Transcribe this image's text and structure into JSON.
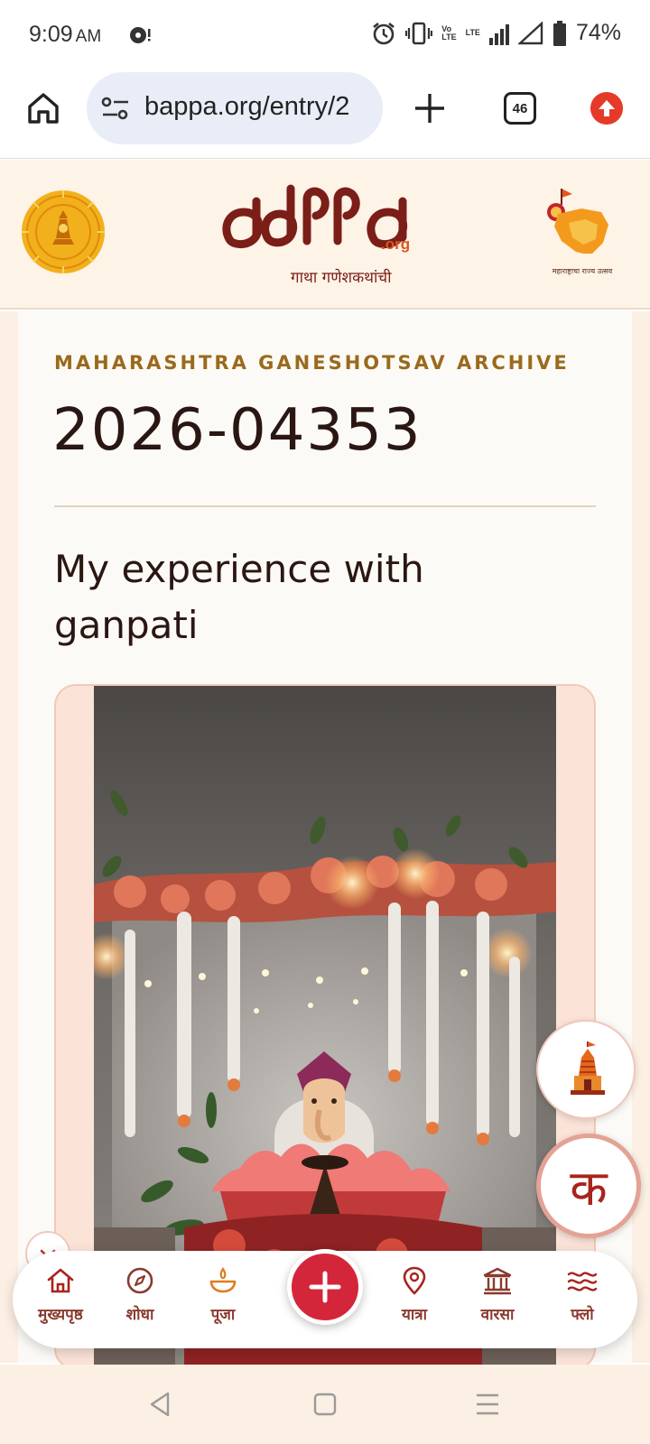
{
  "status_bar": {
    "time": "9:09",
    "ampm": "AM",
    "net_volte": "Vo\nLTE",
    "net_lte": "LTE",
    "battery": "74%"
  },
  "browser": {
    "url": "bappa.org/entry/2",
    "tab_count": "46"
  },
  "header": {
    "logo_wordmark": "bappa",
    "logo_org": ".org",
    "logo_tagline": "गाथा गणेशकथांची",
    "emblem_caption": "महाराष्ट्राचा राज्य उत्सव"
  },
  "entry": {
    "kicker": "MAHARASHTRA GANESHOTSAV ARCHIVE",
    "id": "2026-04353",
    "title": "My experience with ganpati"
  },
  "fab": {
    "ka_glyph": "क"
  },
  "bottom_nav": {
    "items": [
      {
        "label": "मुख्यपृष्ठ",
        "icon": "home-icon"
      },
      {
        "label": "शोधा",
        "icon": "compass-icon"
      },
      {
        "label": "पूजा",
        "icon": "diya-icon"
      },
      {
        "label": "यात्रा",
        "icon": "location-pin-icon"
      },
      {
        "label": "वारसा",
        "icon": "heritage-building-icon"
      },
      {
        "label": "फ्लो",
        "icon": "waves-icon"
      }
    ]
  },
  "colors": {
    "brand_maroon": "#7b1e18",
    "accent_red": "#d4263a",
    "kicker_gold": "#9a6a1c",
    "page_cream": "#fcefe3"
  }
}
